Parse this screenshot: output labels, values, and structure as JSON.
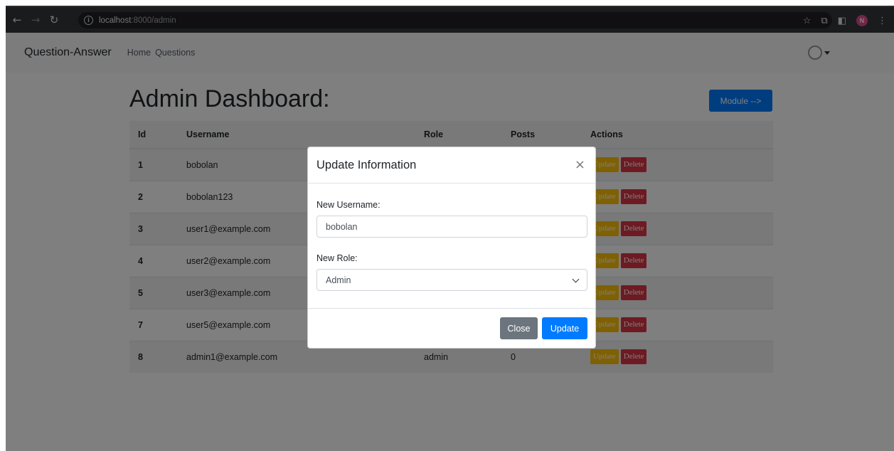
{
  "browser": {
    "url_host": "localhost",
    "url_path": ":8000/admin",
    "profile_initial": "N"
  },
  "navbar": {
    "brand": "Question-Answer",
    "links": [
      "Home",
      "Questions"
    ]
  },
  "dashboard": {
    "title": "Admin Dashboard:",
    "module_button": "Module -->"
  },
  "table": {
    "headers": [
      "Id",
      "Username",
      "Role",
      "Posts",
      "Actions"
    ],
    "rows": [
      {
        "id": "1",
        "username": "bobolan",
        "role": "",
        "posts": ""
      },
      {
        "id": "2",
        "username": "bobolan123",
        "role": "",
        "posts": ""
      },
      {
        "id": "3",
        "username": "user1@example.com",
        "role": "",
        "posts": ""
      },
      {
        "id": "4",
        "username": "user2@example.com",
        "role": "",
        "posts": ""
      },
      {
        "id": "5",
        "username": "user3@example.com",
        "role": "",
        "posts": ""
      },
      {
        "id": "7",
        "username": "user5@example.com",
        "role": "",
        "posts": ""
      },
      {
        "id": "8",
        "username": "admin1@example.com",
        "role": "admin",
        "posts": "0"
      }
    ],
    "update_label": "Update",
    "delete_label": "Delete"
  },
  "modal": {
    "title": "Update Information",
    "close_glyph": "×",
    "username_label": "New Username:",
    "username_value": "bobolan",
    "role_label": "New Role:",
    "role_value": "Admin",
    "close_button": "Close",
    "update_button": "Update"
  },
  "colors": {
    "primary": "#007bff",
    "warning": "#ffc107",
    "danger": "#dc3545",
    "secondary": "#6c757d"
  }
}
